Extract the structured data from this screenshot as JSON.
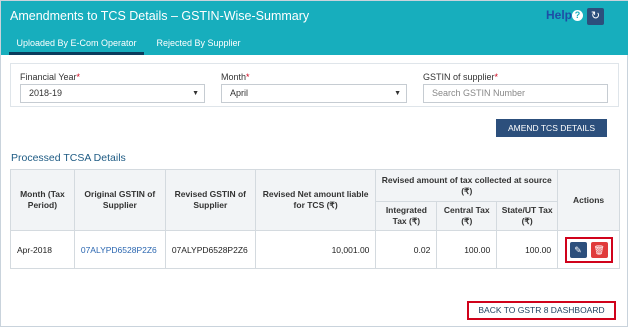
{
  "header": {
    "title": "Amendments to TCS Details – GSTIN-Wise-Summary",
    "help_label": "Help"
  },
  "tabs": [
    {
      "label": "Uploaded By E-Com Operator"
    },
    {
      "label": "Rejected By Supplier"
    }
  ],
  "filters": {
    "financial_year": {
      "label": "Financial Year",
      "value": "2018-19"
    },
    "month": {
      "label": "Month",
      "value": "April"
    },
    "gstin": {
      "label": "GSTIN of supplier",
      "placeholder": "Search GSTIN Number"
    },
    "required_mark": "*"
  },
  "amend_button": "AMEND TCS DETAILS",
  "section_title": "Processed TCSA Details",
  "table": {
    "headers": {
      "month": "Month (Tax Period)",
      "orig_gstin": "Original GSTIN of Supplier",
      "rev_gstin": "Revised GSTIN of Supplier",
      "net_amount": "Revised Net amount liable for TCS (₹)",
      "tax_group": "Revised amount of tax collected at source (₹)",
      "integrated": "Integrated Tax (₹)",
      "central": "Central Tax (₹)",
      "state": "State/UT Tax (₹)",
      "actions": "Actions"
    },
    "rows": [
      {
        "month": "Apr-2018",
        "orig_gstin": "07ALYPD6528P2Z6",
        "rev_gstin": "07ALYPD6528P2Z6",
        "net_amount": "10,001.00",
        "integrated": "0.02",
        "central": "100.00",
        "state": "100.00"
      }
    ]
  },
  "back_button": "BACK TO GSTR 8 DASHBOARD",
  "colors": {
    "header_bg": "#17aebd",
    "primary_btn": "#2c4f7c",
    "delete_btn": "#e03b3b",
    "highlight": "#d0021b"
  },
  "icons": {
    "help": "question-circle-icon",
    "refresh": "refresh-icon",
    "edit": "pencil-icon",
    "delete": "trash-icon",
    "dropdown": "caret-down-icon"
  }
}
